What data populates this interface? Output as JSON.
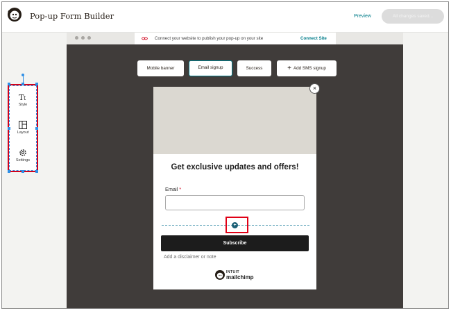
{
  "header": {
    "title": "Pop-up Form Builder",
    "preview_label": "Preview",
    "status_label": "All changes saved..."
  },
  "notice": {
    "text": "Connect your website to publish your pop-up on your site",
    "link_label": "Connect Site"
  },
  "tabs": [
    {
      "label": "Mobile banner"
    },
    {
      "label": "Email signup"
    },
    {
      "label": "Success"
    },
    {
      "label": "Add SMS signup"
    }
  ],
  "popup": {
    "headline": "Get exclusive updates and offers!",
    "email_label": "Email",
    "required_mark": "*",
    "email_value": "",
    "add_field_glyph": "+",
    "subscribe_label": "Subscribe",
    "disclaimer_placeholder": "Add a disclaimer or note",
    "close_glyph": "×",
    "brand_line1": "INTUIT",
    "brand_line2": "mailchimp"
  },
  "toolbar": {
    "items": [
      {
        "label": "Style",
        "icon": "text-style-icon"
      },
      {
        "label": "Layout",
        "icon": "layout-icon"
      },
      {
        "label": "Settings",
        "icon": "gear-icon"
      }
    ]
  },
  "colors": {
    "accent": "#007c89",
    "canvas": "#403c3a",
    "highlight": "#e00016",
    "selection": "#2f8fe6"
  }
}
